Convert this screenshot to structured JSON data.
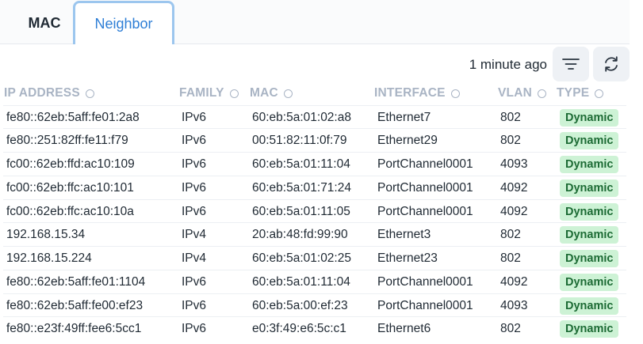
{
  "tabs": [
    {
      "label": "MAC",
      "active": false
    },
    {
      "label": "Neighbor",
      "active": true
    }
  ],
  "toolbar": {
    "last_updated": "1 minute ago",
    "filter_icon": "filter-icon",
    "refresh_icon": "refresh-icon"
  },
  "columns": [
    "IP ADDRESS",
    "FAMILY",
    "MAC",
    "INTERFACE",
    "VLAN",
    "TYPE"
  ],
  "rows": [
    {
      "ip": "fe80::62eb:5aff:fe01:2a8",
      "family": "IPv6",
      "mac": "60:eb:5a:01:02:a8",
      "interface": "Ethernet7",
      "vlan": "802",
      "type": "Dynamic"
    },
    {
      "ip": "fe80::251:82ff:fe11:f79",
      "family": "IPv6",
      "mac": "00:51:82:11:0f:79",
      "interface": "Ethernet29",
      "vlan": "802",
      "type": "Dynamic"
    },
    {
      "ip": "fc00::62eb:ffd:ac10:109",
      "family": "IPv6",
      "mac": "60:eb:5a:01:11:04",
      "interface": "PortChannel0001",
      "vlan": "4093",
      "type": "Dynamic"
    },
    {
      "ip": "fc00::62eb:ffc:ac10:101",
      "family": "IPv6",
      "mac": "60:eb:5a:01:71:24",
      "interface": "PortChannel0001",
      "vlan": "4092",
      "type": "Dynamic"
    },
    {
      "ip": "fc00::62eb:ffc:ac10:10a",
      "family": "IPv6",
      "mac": "60:eb:5a:01:11:05",
      "interface": "PortChannel0001",
      "vlan": "4092",
      "type": "Dynamic"
    },
    {
      "ip": "192.168.15.34",
      "family": "IPv4",
      "mac": "20:ab:48:fd:99:90",
      "interface": "Ethernet3",
      "vlan": "802",
      "type": "Dynamic"
    },
    {
      "ip": "192.168.15.224",
      "family": "IPv4",
      "mac": "60:eb:5a:01:02:25",
      "interface": "Ethernet23",
      "vlan": "802",
      "type": "Dynamic"
    },
    {
      "ip": "fe80::62eb:5aff:fe01:1104",
      "family": "IPv6",
      "mac": "60:eb:5a:01:11:04",
      "interface": "PortChannel0001",
      "vlan": "4092",
      "type": "Dynamic"
    },
    {
      "ip": "fe80::62eb:5aff:fe00:ef23",
      "family": "IPv6",
      "mac": "60:eb:5a:00:ef:23",
      "interface": "PortChannel0001",
      "vlan": "4093",
      "type": "Dynamic"
    },
    {
      "ip": "fe80::e23f:49ff:fee6:5cc1",
      "family": "IPv6",
      "mac": "e0:3f:49:e6:5c:c1",
      "interface": "Ethernet6",
      "vlan": "802",
      "type": "Dynamic"
    }
  ],
  "colors": {
    "accent": "#2f7fd6",
    "badge_bg": "#cdf2d5",
    "badge_text": "#1c6b34",
    "header_text": "#a9b4c4"
  }
}
